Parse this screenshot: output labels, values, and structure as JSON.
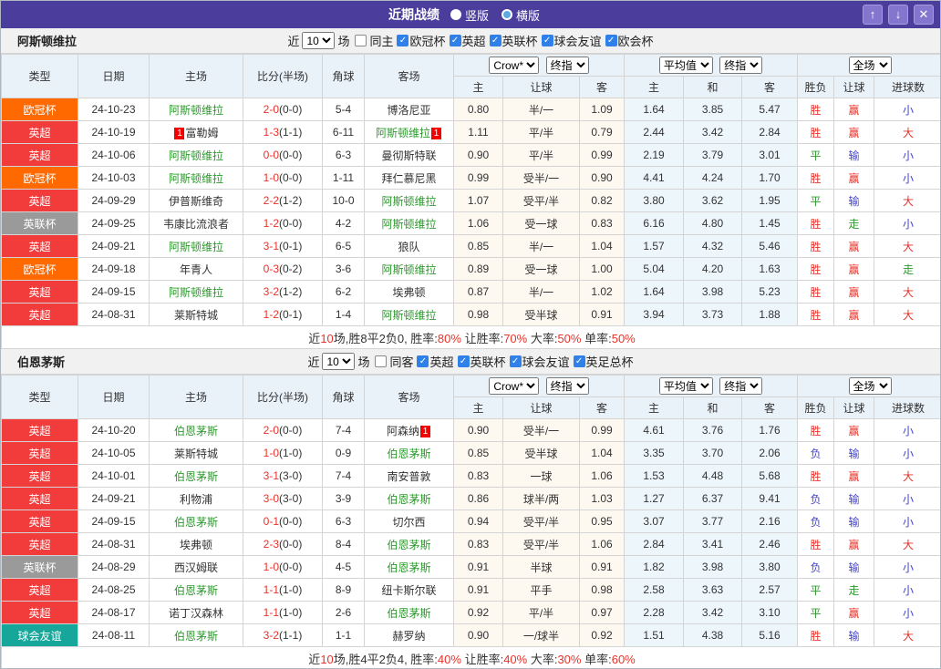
{
  "title_bar": {
    "title": "近期战绩",
    "vertical": "竖版",
    "horizontal": "横版",
    "up": "↑",
    "down": "↓",
    "close": "✕"
  },
  "columns": {
    "type": "类型",
    "date": "日期",
    "home": "主场",
    "score": "比分(半场)",
    "corner": "角球",
    "away": "客场",
    "odds_home": "主",
    "handicap": "让球",
    "odds_away": "客",
    "avg_home": "主",
    "avg_draw": "和",
    "avg_away": "客",
    "result": "胜负",
    "handicap_result": "让球",
    "goals": "进球数"
  },
  "league_colors": {
    "欧冠杯": "#ff6900",
    "英超": "#f23c3c",
    "英联杯": "#9a9a9a",
    "球会友谊": "#17a69a"
  },
  "result_colors": {
    "r": "#e8322a",
    "g": "#2d9a2d",
    "b": "#4444cc"
  },
  "sections": [
    {
      "team": "阿斯顿维拉",
      "filter": {
        "near": "近",
        "count": "10",
        "unit": "场",
        "same": "同主",
        "leagues": [
          "欧冠杯",
          "英超",
          "英联杯",
          "球会友谊",
          "欧会杯"
        ]
      },
      "dropdowns": {
        "company": "Crow*",
        "final1": "终指",
        "average": "平均值",
        "final2": "终指",
        "scope": "全场"
      },
      "rows": [
        {
          "lg": "欧冠杯",
          "date": "24-10-23",
          "home": "阿斯顿维拉",
          "hf": true,
          "score": "2-0",
          "half": "(0-0)",
          "corner": "5-4",
          "away": "博洛尼亚",
          "o": [
            "0.80",
            "半/一",
            "1.09"
          ],
          "avg": [
            "1.64",
            "3.85",
            "5.47"
          ],
          "res": [
            [
              "胜",
              "r"
            ],
            [
              "赢",
              "r"
            ],
            [
              "小",
              "b"
            ]
          ]
        },
        {
          "lg": "英超",
          "date": "24-10-19",
          "home": "富勒姆",
          "hr": "1",
          "score": "1-3",
          "half": "(1-1)",
          "corner": "6-11",
          "away": "阿斯顿维拉",
          "af": true,
          "ar": "1",
          "o": [
            "1.11",
            "平/半",
            "0.79"
          ],
          "avg": [
            "2.44",
            "3.42",
            "2.84"
          ],
          "res": [
            [
              "胜",
              "r"
            ],
            [
              "赢",
              "r"
            ],
            [
              "大",
              "r"
            ]
          ]
        },
        {
          "lg": "英超",
          "date": "24-10-06",
          "home": "阿斯顿维拉",
          "hf": true,
          "score": "0-0",
          "half": "(0-0)",
          "corner": "6-3",
          "away": "曼彻斯特联",
          "o": [
            "0.90",
            "平/半",
            "0.99"
          ],
          "avg": [
            "2.19",
            "3.79",
            "3.01"
          ],
          "res": [
            [
              "平",
              "g"
            ],
            [
              "输",
              "b"
            ],
            [
              "小",
              "b"
            ]
          ]
        },
        {
          "lg": "欧冠杯",
          "date": "24-10-03",
          "home": "阿斯顿维拉",
          "hf": true,
          "score": "1-0",
          "half": "(0-0)",
          "corner": "1-11",
          "away": "拜仁慕尼黑",
          "o": [
            "0.99",
            "受半/一",
            "0.90"
          ],
          "avg": [
            "4.41",
            "4.24",
            "1.70"
          ],
          "res": [
            [
              "胜",
              "r"
            ],
            [
              "赢",
              "r"
            ],
            [
              "小",
              "b"
            ]
          ]
        },
        {
          "lg": "英超",
          "date": "24-09-29",
          "home": "伊普斯维奇",
          "score": "2-2",
          "half": "(1-2)",
          "corner": "10-0",
          "away": "阿斯顿维拉",
          "af": true,
          "o": [
            "1.07",
            "受平/半",
            "0.82"
          ],
          "avg": [
            "3.80",
            "3.62",
            "1.95"
          ],
          "res": [
            [
              "平",
              "g"
            ],
            [
              "输",
              "b"
            ],
            [
              "大",
              "r"
            ]
          ]
        },
        {
          "lg": "英联杯",
          "date": "24-09-25",
          "home": "韦康比流浪者",
          "score": "1-2",
          "half": "(0-0)",
          "corner": "4-2",
          "away": "阿斯顿维拉",
          "af": true,
          "o": [
            "1.06",
            "受一球",
            "0.83"
          ],
          "avg": [
            "6.16",
            "4.80",
            "1.45"
          ],
          "res": [
            [
              "胜",
              "r"
            ],
            [
              "走",
              "g"
            ],
            [
              "小",
              "b"
            ]
          ]
        },
        {
          "lg": "英超",
          "date": "24-09-21",
          "home": "阿斯顿维拉",
          "hf": true,
          "score": "3-1",
          "half": "(0-1)",
          "corner": "6-5",
          "away": "狼队",
          "o": [
            "0.85",
            "半/一",
            "1.04"
          ],
          "avg": [
            "1.57",
            "4.32",
            "5.46"
          ],
          "res": [
            [
              "胜",
              "r"
            ],
            [
              "赢",
              "r"
            ],
            [
              "大",
              "r"
            ]
          ]
        },
        {
          "lg": "欧冠杯",
          "date": "24-09-18",
          "home": "年青人",
          "score": "0-3",
          "half": "(0-2)",
          "corner": "3-6",
          "away": "阿斯顿维拉",
          "af": true,
          "o": [
            "0.89",
            "受一球",
            "1.00"
          ],
          "avg": [
            "5.04",
            "4.20",
            "1.63"
          ],
          "res": [
            [
              "胜",
              "r"
            ],
            [
              "赢",
              "r"
            ],
            [
              "走",
              "g"
            ]
          ]
        },
        {
          "lg": "英超",
          "date": "24-09-15",
          "home": "阿斯顿维拉",
          "hf": true,
          "score": "3-2",
          "half": "(1-2)",
          "corner": "6-2",
          "away": "埃弗顿",
          "o": [
            "0.87",
            "半/一",
            "1.02"
          ],
          "avg": [
            "1.64",
            "3.98",
            "5.23"
          ],
          "res": [
            [
              "胜",
              "r"
            ],
            [
              "赢",
              "r"
            ],
            [
              "大",
              "r"
            ]
          ]
        },
        {
          "lg": "英超",
          "date": "24-08-31",
          "home": "莱斯特城",
          "score": "1-2",
          "half": "(0-1)",
          "corner": "1-4",
          "away": "阿斯顿维拉",
          "af": true,
          "o": [
            "0.98",
            "受半球",
            "0.91"
          ],
          "avg": [
            "3.94",
            "3.73",
            "1.88"
          ],
          "res": [
            [
              "胜",
              "r"
            ],
            [
              "赢",
              "r"
            ],
            [
              "大",
              "r"
            ]
          ]
        }
      ],
      "summary": {
        "pre": "近",
        "n": "10",
        "mid": "场,胜8平2负0, 胜率:",
        "win": "80%",
        "l2": " 让胜率:",
        "hcp": "70%",
        "l3": " 大率:",
        "big": "50%",
        "l4": " 单率:",
        "single": "50%"
      }
    },
    {
      "team": "伯恩茅斯",
      "filter": {
        "near": "近",
        "count": "10",
        "unit": "场",
        "same": "同客",
        "leagues": [
          "英超",
          "英联杯",
          "球会友谊",
          "英足总杯"
        ]
      },
      "dropdowns": {
        "company": "Crow*",
        "final1": "终指",
        "average": "平均值",
        "final2": "终指",
        "scope": "全场"
      },
      "rows": [
        {
          "lg": "英超",
          "date": "24-10-20",
          "home": "伯恩茅斯",
          "hf": true,
          "score": "2-0",
          "half": "(0-0)",
          "corner": "7-4",
          "away": "阿森纳",
          "ar": "1",
          "o": [
            "0.90",
            "受半/一",
            "0.99"
          ],
          "avg": [
            "4.61",
            "3.76",
            "1.76"
          ],
          "res": [
            [
              "胜",
              "r"
            ],
            [
              "赢",
              "r"
            ],
            [
              "小",
              "b"
            ]
          ]
        },
        {
          "lg": "英超",
          "date": "24-10-05",
          "home": "莱斯特城",
          "score": "1-0",
          "half": "(1-0)",
          "corner": "0-9",
          "away": "伯恩茅斯",
          "af": true,
          "o": [
            "0.85",
            "受半球",
            "1.04"
          ],
          "avg": [
            "3.35",
            "3.70",
            "2.06"
          ],
          "res": [
            [
              "负",
              "b"
            ],
            [
              "输",
              "b"
            ],
            [
              "小",
              "b"
            ]
          ]
        },
        {
          "lg": "英超",
          "date": "24-10-01",
          "home": "伯恩茅斯",
          "hf": true,
          "score": "3-1",
          "half": "(3-0)",
          "corner": "7-4",
          "away": "南安普敦",
          "o": [
            "0.83",
            "一球",
            "1.06"
          ],
          "avg": [
            "1.53",
            "4.48",
            "5.68"
          ],
          "res": [
            [
              "胜",
              "r"
            ],
            [
              "赢",
              "r"
            ],
            [
              "大",
              "r"
            ]
          ]
        },
        {
          "lg": "英超",
          "date": "24-09-21",
          "home": "利物浦",
          "score": "3-0",
          "half": "(3-0)",
          "corner": "3-9",
          "away": "伯恩茅斯",
          "af": true,
          "o": [
            "0.86",
            "球半/两",
            "1.03"
          ],
          "avg": [
            "1.27",
            "6.37",
            "9.41"
          ],
          "res": [
            [
              "负",
              "b"
            ],
            [
              "输",
              "b"
            ],
            [
              "小",
              "b"
            ]
          ]
        },
        {
          "lg": "英超",
          "date": "24-09-15",
          "home": "伯恩茅斯",
          "hf": true,
          "score": "0-1",
          "half": "(0-0)",
          "corner": "6-3",
          "away": "切尔西",
          "o": [
            "0.94",
            "受平/半",
            "0.95"
          ],
          "avg": [
            "3.07",
            "3.77",
            "2.16"
          ],
          "res": [
            [
              "负",
              "b"
            ],
            [
              "输",
              "b"
            ],
            [
              "小",
              "b"
            ]
          ]
        },
        {
          "lg": "英超",
          "date": "24-08-31",
          "home": "埃弗顿",
          "score": "2-3",
          "half": "(0-0)",
          "corner": "8-4",
          "away": "伯恩茅斯",
          "af": true,
          "o": [
            "0.83",
            "受平/半",
            "1.06"
          ],
          "avg": [
            "2.84",
            "3.41",
            "2.46"
          ],
          "res": [
            [
              "胜",
              "r"
            ],
            [
              "赢",
              "r"
            ],
            [
              "大",
              "r"
            ]
          ]
        },
        {
          "lg": "英联杯",
          "date": "24-08-29",
          "home": "西汉姆联",
          "score": "1-0",
          "half": "(0-0)",
          "corner": "4-5",
          "away": "伯恩茅斯",
          "af": true,
          "o": [
            "0.91",
            "半球",
            "0.91"
          ],
          "avg": [
            "1.82",
            "3.98",
            "3.80"
          ],
          "res": [
            [
              "负",
              "b"
            ],
            [
              "输",
              "b"
            ],
            [
              "小",
              "b"
            ]
          ]
        },
        {
          "lg": "英超",
          "date": "24-08-25",
          "home": "伯恩茅斯",
          "hf": true,
          "score": "1-1",
          "half": "(1-0)",
          "corner": "8-9",
          "away": "纽卡斯尔联",
          "o": [
            "0.91",
            "平手",
            "0.98"
          ],
          "avg": [
            "2.58",
            "3.63",
            "2.57"
          ],
          "res": [
            [
              "平",
              "g"
            ],
            [
              "走",
              "g"
            ],
            [
              "小",
              "b"
            ]
          ]
        },
        {
          "lg": "英超",
          "date": "24-08-17",
          "home": "诺丁汉森林",
          "score": "1-1",
          "half": "(1-0)",
          "corner": "2-6",
          "away": "伯恩茅斯",
          "af": true,
          "o": [
            "0.92",
            "平/半",
            "0.97"
          ],
          "avg": [
            "2.28",
            "3.42",
            "3.10"
          ],
          "res": [
            [
              "平",
              "g"
            ],
            [
              "赢",
              "r"
            ],
            [
              "小",
              "b"
            ]
          ]
        },
        {
          "lg": "球会友谊",
          "date": "24-08-11",
          "home": "伯恩茅斯",
          "hf": true,
          "score": "3-2",
          "half": "(1-1)",
          "corner": "1-1",
          "away": "赫罗纳",
          "o": [
            "0.90",
            "一/球半",
            "0.92"
          ],
          "avg": [
            "1.51",
            "4.38",
            "5.16"
          ],
          "res": [
            [
              "胜",
              "r"
            ],
            [
              "输",
              "b"
            ],
            [
              "大",
              "r"
            ]
          ]
        }
      ],
      "summary": {
        "pre": "近",
        "n": "10",
        "mid": "场,胜4平2负4, 胜率:",
        "win": "40%",
        "l2": " 让胜率:",
        "hcp": "40%",
        "l3": " 大率:",
        "big": "30%",
        "l4": " 单率:",
        "single": "60%"
      }
    }
  ]
}
